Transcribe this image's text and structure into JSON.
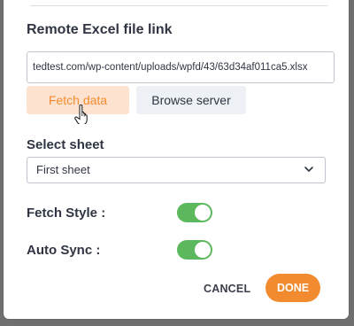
{
  "dialog": {
    "remote_link_label": "Remote Excel file link",
    "remote_link_value": "tedtest.com/wp-content/uploads/wpfd/43/63d34af011ca5.xlsx",
    "fetch_button": "Fetch data",
    "browse_button": "Browse server",
    "select_sheet_label": "Select sheet",
    "select_sheet_value": "First sheet",
    "fetch_style_label": "Fetch Style :",
    "fetch_style_on": true,
    "auto_sync_label": "Auto Sync :",
    "auto_sync_on": true,
    "cancel_button": "CANCEL",
    "done_button": "DONE"
  },
  "colors": {
    "accent": "#f28b2f",
    "toggle_on": "#5cb85c"
  }
}
